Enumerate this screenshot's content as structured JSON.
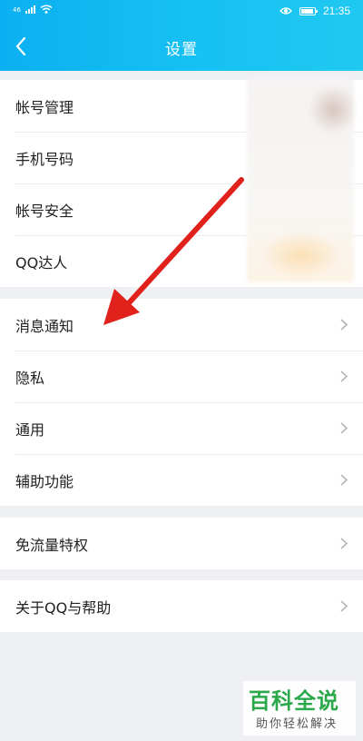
{
  "status_bar": {
    "signal_text": "46",
    "time": "21:35"
  },
  "header": {
    "title": "设置",
    "back_icon": "chevron-left-icon"
  },
  "groups": [
    {
      "items": [
        {
          "label": "帐号管理",
          "chevron": false
        },
        {
          "label": "手机号码",
          "chevron": false
        },
        {
          "label": "帐号安全",
          "chevron": false
        },
        {
          "label": "QQ达人",
          "chevron": false
        }
      ]
    },
    {
      "items": [
        {
          "label": "消息通知",
          "chevron": true
        },
        {
          "label": "隐私",
          "chevron": true
        },
        {
          "label": "通用",
          "chevron": true
        },
        {
          "label": "辅助功能",
          "chevron": true
        }
      ]
    },
    {
      "items": [
        {
          "label": "免流量特权",
          "chevron": true
        }
      ]
    },
    {
      "items": [
        {
          "label": "关于QQ与帮助",
          "chevron": true
        }
      ]
    }
  ],
  "watermark": {
    "title": "百科全说",
    "subtitle": "助你轻松解决"
  },
  "colors": {
    "header_start": "#0bb0f2",
    "header_end": "#1fc9f0",
    "background": "#eef0f4",
    "arrow": "#e0211c",
    "watermark_green": "#2aa84a"
  }
}
